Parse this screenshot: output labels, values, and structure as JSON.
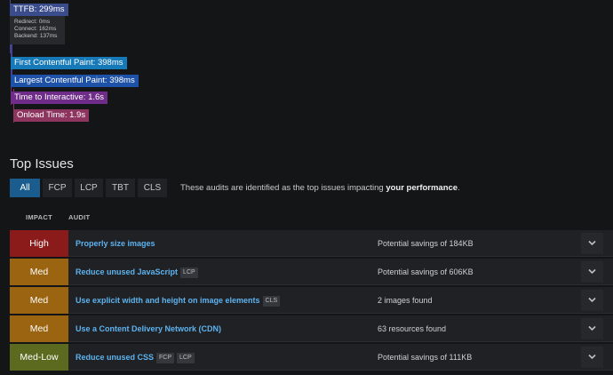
{
  "timeline": {
    "ttfb": {
      "label": "TTFB: 299ms",
      "details": [
        "Redirect: 0ms",
        "Connect: 162ms",
        "Backend: 137ms"
      ]
    },
    "markers": [
      {
        "label": "First Contentful Paint: 398ms",
        "color": "#1679b8"
      },
      {
        "label": "Largest Contentful Paint: 398ms",
        "color": "#1d52a8"
      },
      {
        "label": "Time to Interactive: 1.6s",
        "color": "#6f2d89"
      },
      {
        "label": "Onload Time: 1.9s",
        "color": "#8e355f"
      }
    ],
    "ttfb_color": "#3b4c8c"
  },
  "top_issues": {
    "title": "Top Issues",
    "tabs": [
      "All",
      "FCP",
      "LCP",
      "TBT",
      "CLS"
    ],
    "active_tab": "All",
    "note_prefix": "These audits are identified as the top issues impacting ",
    "note_bold": "your performance",
    "note_suffix": ".",
    "columns": {
      "impact": "IMPACT",
      "audit": "AUDIT"
    },
    "rows": [
      {
        "impact": "High",
        "impact_color": "#8b1a1a",
        "audit": "Properly size images",
        "badges": [],
        "savings": "Potential savings of 184KB"
      },
      {
        "impact": "Med",
        "impact_color": "#9a6410",
        "audit": "Reduce unused JavaScript",
        "badges": [
          "LCP"
        ],
        "savings": "Potential savings of 606KB"
      },
      {
        "impact": "Med",
        "impact_color": "#9a6410",
        "audit": "Use explicit width and height on image elements",
        "badges": [
          "CLS"
        ],
        "savings": "2 images found"
      },
      {
        "impact": "Med",
        "impact_color": "#9a6410",
        "audit": "Use a Content Delivery Network (CDN)",
        "badges": [],
        "savings": "63 resources found"
      },
      {
        "impact": "Med-Low",
        "impact_color": "#5b6a1f",
        "audit": "Reduce unused CSS",
        "badges": [
          "FCP",
          "LCP"
        ],
        "savings": "Potential savings of 111KB"
      }
    ]
  }
}
